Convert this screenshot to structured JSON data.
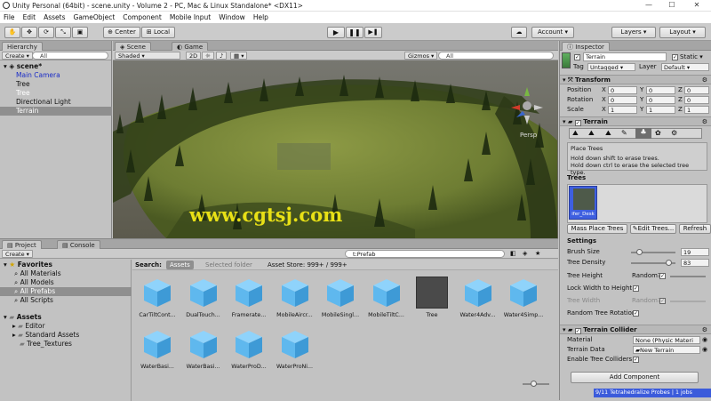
{
  "window": {
    "title": "Unity Personal (64bit) - scene.unity - Volume 2 - PC, Mac & Linux Standalone* <DX11>",
    "minimize": "—",
    "maximize": "☐",
    "close": "✕"
  },
  "menu": [
    "File",
    "Edit",
    "Assets",
    "GameObject",
    "Component",
    "Mobile Input",
    "Window",
    "Help"
  ],
  "toolbar": {
    "center": "Center",
    "local": "Local",
    "account": "Account",
    "layers": "Layers",
    "layout": "Layout"
  },
  "hierarchy": {
    "tab": "Hierarchy",
    "create": "Create",
    "search_placeholder": "All",
    "scene": "scene*",
    "items": [
      {
        "label": "Main Camera",
        "color": "#111111"
      },
      {
        "label": "Tree",
        "color": "#1a2cc7"
      },
      {
        "label": "Tree",
        "color": "#1a2cc7"
      },
      {
        "label": "Directional Light",
        "color": "#111111"
      },
      {
        "label": "Terrain",
        "color": "#ffffff"
      }
    ]
  },
  "scene": {
    "tab_scene": "Scene",
    "tab_game": "Game",
    "shading": "Shaded",
    "mode2d": "2D",
    "gizmos": "Gizmos",
    "search_placeholder": "All",
    "persp": "Persp",
    "watermark": "www.cgtsj.com"
  },
  "inspector": {
    "tab": "Inspector",
    "object_name": "Terrain",
    "static": "Static",
    "tag_label": "Tag",
    "tag_value": "Untagged",
    "layer_label": "Layer",
    "layer_value": "Default",
    "transform": {
      "title": "Transform",
      "rows": [
        {
          "label": "Position",
          "x": "0",
          "y": "0",
          "z": "0"
        },
        {
          "label": "Rotation",
          "x": "0",
          "y": "0",
          "z": "0"
        },
        {
          "label": "Scale",
          "x": "1",
          "y": "1",
          "z": "1"
        }
      ]
    },
    "terrain": {
      "title": "Terrain",
      "tool_title": "Place Trees",
      "help_line1": "Hold down shift to erase trees.",
      "help_line2": "Hold down ctrl to erase the selected tree type.",
      "trees_label": "Trees",
      "tree_thumb": "ifer_Desk",
      "buttons": [
        "Mass Place Trees",
        "Edit Trees...",
        "Refresh"
      ],
      "settings_label": "Settings",
      "brush_size_label": "Brush Size",
      "brush_size": "19",
      "brush_size_frac": 0.18,
      "density_label": "Tree Density",
      "density": "83",
      "density_frac": 0.83,
      "height_label": "Tree Height",
      "random": "Random?",
      "lock_label": "Lock Width to Height",
      "width_label": "Tree Width",
      "color_label": "Random Tree Rotation"
    },
    "collider": {
      "title": "Terrain Collider",
      "material_label": "Material",
      "material_value": "None (Physic Materi",
      "data_label": "Terrain Data",
      "data_value": "New Terrain",
      "enable_label": "Enable Tree Colliders"
    },
    "add_component": "Add Component",
    "status": "9/11 Tetrahedralize Probes | 1 jobs"
  },
  "project": {
    "tab_project": "Project",
    "tab_console": "Console",
    "create": "Create",
    "search_value": "t:Prefab",
    "search_label": "Search:",
    "scope_assets": "Assets",
    "scope_selected": "Selected folder",
    "asset_store": "Asset Store: 999+ / 999+",
    "favorites": "Favorites",
    "fav_items": [
      "All Materials",
      "All Models",
      "All Prefabs",
      "All Scripts"
    ],
    "assets_root": "Assets",
    "folders": [
      "Editor",
      "Standard Assets",
      "Tree_Textures"
    ],
    "grid_row1": [
      "CarTiltCont...",
      "DualTouch...",
      "Framerate...",
      "MobileAircr...",
      "MobileSingl...",
      "MobileTiltC...",
      "Tree",
      "Water4Adv...",
      "Water4Simp..."
    ],
    "grid_row2": [
      "WaterBasi...",
      "WaterBasi...",
      "WaterProD...",
      "WaterProNi..."
    ]
  },
  "colors": {
    "cube": "#5fb8ee",
    "selection": "#8f8f8f",
    "status_bar": "#3b5bdb",
    "watermark": "#e8e016"
  }
}
